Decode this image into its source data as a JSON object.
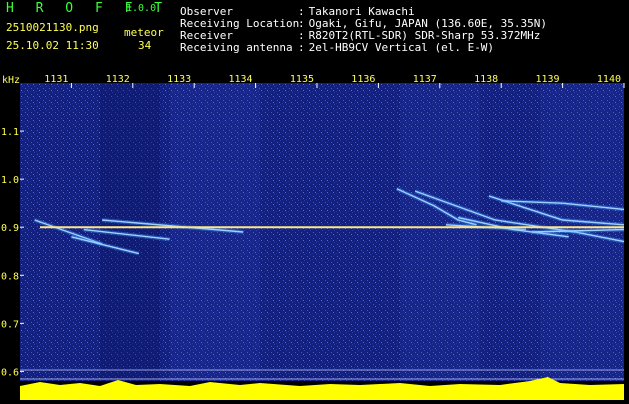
{
  "header": {
    "app_title": "H R O F F T",
    "app_version": "1.0.0",
    "filename": "2510021130.png",
    "datetime": "25.10.02 11:30",
    "meteor_label": "meteor",
    "meteor_count": "34",
    "info": [
      {
        "label": "Observer",
        "value": "Takanori Kawachi"
      },
      {
        "label": "Receiving Location",
        "value": "Ogaki, Gifu, JAPAN (136.60E, 35.35N)"
      },
      {
        "label": "Receiver",
        "value": "R820T2(RTL-SDR) SDR-Sharp 53.372MHz"
      },
      {
        "label": "Receiving antenna",
        "value": "2el-HB9CV Vertical (el. E-W)"
      }
    ]
  },
  "chart_data": {
    "type": "heatmap",
    "ylabel": "kHz",
    "x_ticks": [
      "1131",
      "1132",
      "1133",
      "1134",
      "1135",
      "1136",
      "1137",
      "1138",
      "1139",
      "1140"
    ],
    "x_range": [
      1130,
      1140
    ],
    "y_ticks": [
      "1.1",
      "1.0",
      "0.9",
      "0.8",
      "0.7",
      "0.6"
    ],
    "y_range": [
      0.58,
      1.2
    ],
    "carrier_khz": 0.9,
    "traces": [
      {
        "points": [
          [
            1130.4,
            0.915
          ],
          [
            1131.5,
            0.865
          ]
        ]
      },
      {
        "points": [
          [
            1131.0,
            0.88
          ],
          [
            1132.1,
            0.845
          ]
        ]
      },
      {
        "points": [
          [
            1131.2,
            0.895
          ],
          [
            1132.6,
            0.875
          ]
        ]
      },
      {
        "points": [
          [
            1131.5,
            0.915
          ],
          [
            1133.8,
            0.89
          ]
        ]
      },
      {
        "points": [
          [
            1136.3,
            0.98
          ],
          [
            1136.9,
            0.945
          ],
          [
            1137.3,
            0.915
          ],
          [
            1137.6,
            0.905
          ]
        ]
      },
      {
        "points": [
          [
            1136.6,
            0.975
          ],
          [
            1137.9,
            0.915
          ],
          [
            1139.2,
            0.89
          ],
          [
            1140.0,
            0.87
          ]
        ]
      },
      {
        "points": [
          [
            1137.1,
            0.905
          ],
          [
            1138.4,
            0.895
          ]
        ]
      },
      {
        "points": [
          [
            1137.3,
            0.92
          ],
          [
            1138.2,
            0.895
          ],
          [
            1139.1,
            0.88
          ]
        ]
      },
      {
        "points": [
          [
            1137.8,
            0.965
          ],
          [
            1139.0,
            0.915
          ],
          [
            1140.0,
            0.905
          ]
        ]
      },
      {
        "points": [
          [
            1138.0,
            0.955
          ],
          [
            1139.0,
            0.95
          ],
          [
            1140.0,
            0.937
          ]
        ]
      },
      {
        "points": [
          [
            1138.5,
            0.89
          ],
          [
            1140.0,
            0.895
          ]
        ]
      }
    ],
    "colors": {
      "background": "#13207e",
      "carrier": "#ffe680",
      "trace": "#9fd0ff",
      "bottom_band": "#ffff00",
      "labels": "#ffff55",
      "title": "#3cff3c"
    }
  }
}
